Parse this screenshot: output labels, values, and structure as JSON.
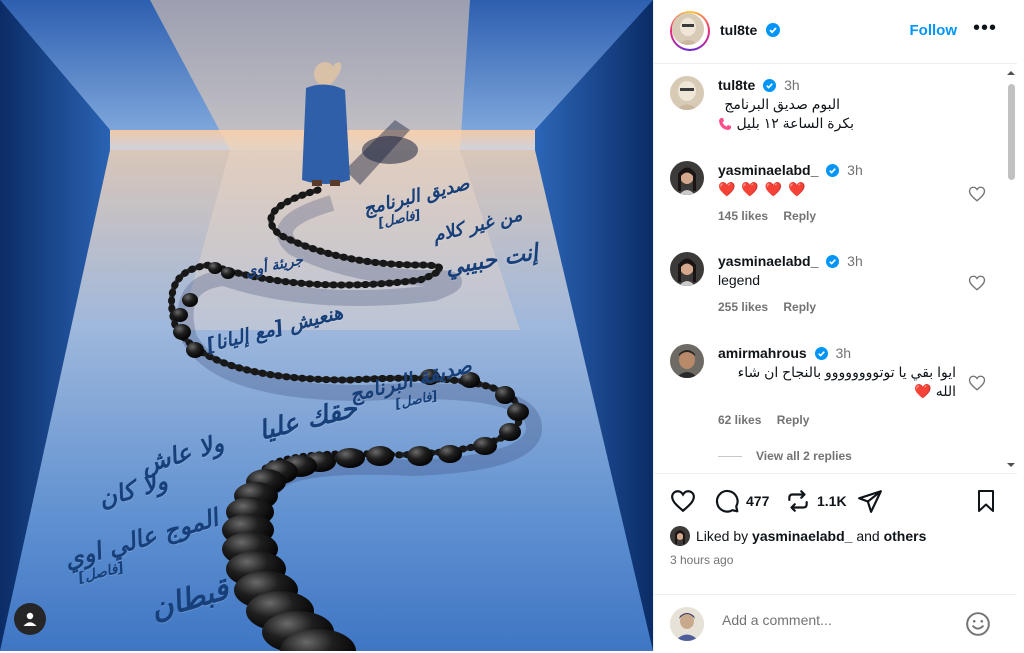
{
  "post": {
    "username": "tul8te",
    "follow_label": "Follow",
    "more_icon": "more-horizontal-icon",
    "caption_user": "tul8te",
    "caption_time": "3h",
    "caption_line1": "البوم صديق البرنامج",
    "caption_line2": "بكرة الساعة ١٢ بليل",
    "artwork_lines": [
      "صديق البرنامج",
      "[فاصل]",
      "من غير كلام",
      "إنت حبيبي",
      "جريئة أوي",
      "هنعيش [مع إليانا]",
      "صديقة البرنامج",
      "[فاصل]",
      "حقك عليا",
      "ولا عاش",
      "ولا كان",
      "الموج عالي اوي",
      "[فاصل]",
      "قبطان"
    ]
  },
  "comments": [
    {
      "user": "yasminaelabd_",
      "time": "3h",
      "text": "❤️ ❤️ ❤️ ❤️",
      "likes": "145 likes",
      "reply": "Reply"
    },
    {
      "user": "yasminaelabd_",
      "time": "3h",
      "text": "legend",
      "likes": "255 likes",
      "reply": "Reply"
    },
    {
      "user": "amirmahrous",
      "time": "3h",
      "text": "ايوا بقي يا توتوووووووو بالنجاح ان شاء الله ❤️",
      "likes": "62 likes",
      "reply": "Reply"
    }
  ],
  "view_replies": "View all 2 replies",
  "stats": {
    "comments_count": "477",
    "reposts_count": "1.1K",
    "liked_by_prefix": "Liked by",
    "liked_by_user": "yasminaelabd_",
    "liked_by_and": "and",
    "liked_by_others": "others",
    "time_ago": "3 hours ago"
  },
  "add_comment": {
    "placeholder": "Add a comment..."
  },
  "colors": {
    "accent": "#0095f6",
    "verified": "#0095f6",
    "heart": "#ff3040",
    "muted": "#737373"
  }
}
